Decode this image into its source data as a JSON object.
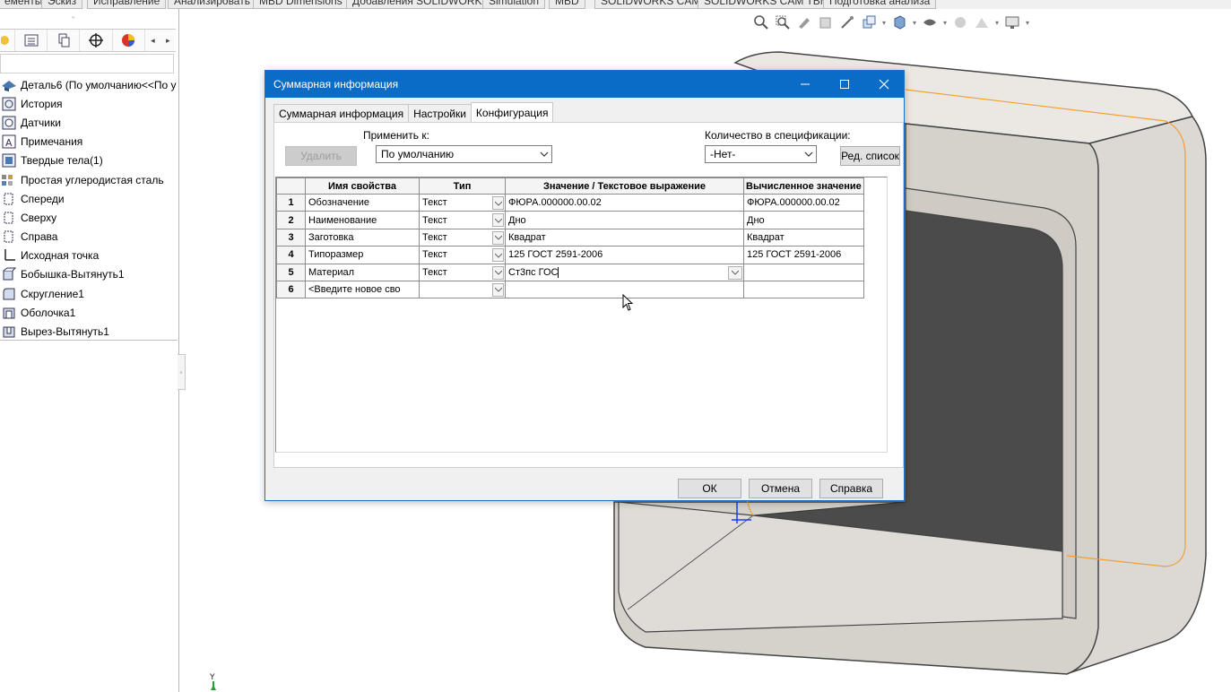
{
  "ribbon": {
    "tabs": [
      "ементы",
      "Эскиз",
      "Исправление",
      "Анализировать",
      "MBD Dimensions",
      "Добавления SOLIDWORKS",
      "Simulation",
      "MBD",
      "SOLIDWORKS CAM",
      "SOLIDWORKS CAM TBM",
      "Подготовка анализа"
    ]
  },
  "feature_tree": {
    "items": [
      {
        "label": "Деталь6  (По умолчанию<<По у",
        "icon": "part-icon"
      },
      {
        "label": "История",
        "icon": "history-icon"
      },
      {
        "label": "Датчики",
        "icon": "sensors-icon"
      },
      {
        "label": "Примечания",
        "icon": "annotations-icon"
      },
      {
        "label": "Твердые тела(1)",
        "icon": "solid-bodies-icon"
      },
      {
        "label": "Простая углеродистая сталь",
        "icon": "material-icon"
      },
      {
        "label": "Спереди",
        "icon": "plane-icon"
      },
      {
        "label": "Сверху",
        "icon": "plane-icon"
      },
      {
        "label": "Справа",
        "icon": "plane-icon"
      },
      {
        "label": "Исходная точка",
        "icon": "origin-icon"
      },
      {
        "label": "Бобышка-Вытянуть1",
        "icon": "extrude-icon"
      },
      {
        "label": "Скругление1",
        "icon": "fillet-icon"
      },
      {
        "label": "Оболочка1",
        "icon": "shell-icon"
      },
      {
        "label": "Вырез-Вытянуть1",
        "icon": "cut-extrude-icon"
      }
    ]
  },
  "triad": {
    "axis_label": "Y"
  },
  "dialog": {
    "title": "Суммарная информация",
    "tabs": [
      "Суммарная информация",
      "Настройки",
      "Конфигурация"
    ],
    "active_tab": "Конфигурация",
    "delete_label": "Удалить",
    "apply_to_label": "Применить к:",
    "apply_to_value": "По умолчанию",
    "bom_qty_label": "Количество в спецификации:",
    "bom_qty_value": "-Нет-",
    "edit_list_label": "Ред. список",
    "grid": {
      "headers": [
        "Имя свойства",
        "Тип",
        "Значение / Текстовое выражение",
        "Вычисленное значение"
      ],
      "rows": [
        {
          "num": "1",
          "name": "Обозначение",
          "type": "Текст",
          "value": "ФЮРА.000000.00.02",
          "evaluated": "ФЮРА.000000.00.02"
        },
        {
          "num": "2",
          "name": "Наименование",
          "type": "Текст",
          "value": "Дно",
          "evaluated": "Дно"
        },
        {
          "num": "3",
          "name": "Заготовка",
          "type": "Текст",
          "value": "Квадрат",
          "evaluated": "Квадрат"
        },
        {
          "num": "4",
          "name": "Типоразмер",
          "type": "Текст",
          "value": "125 ГОСТ 2591-2006",
          "evaluated": "125 ГОСТ 2591-2006"
        },
        {
          "num": "5",
          "name": "Материал",
          "type": "Текст",
          "value": "Ст3пс ГОС",
          "evaluated": ""
        },
        {
          "num": "6",
          "name": "<Введите новое сво",
          "type": "",
          "value": "",
          "evaluated": ""
        }
      ]
    },
    "ok_label": "ОК",
    "cancel_label": "Отмена",
    "help_label": "Справка"
  },
  "colors": {
    "title_bar": "#0b6cc8",
    "model_face": "#d8d4cf",
    "model_dark": "#4a4a4a",
    "selection_edge": "#f0a030"
  }
}
